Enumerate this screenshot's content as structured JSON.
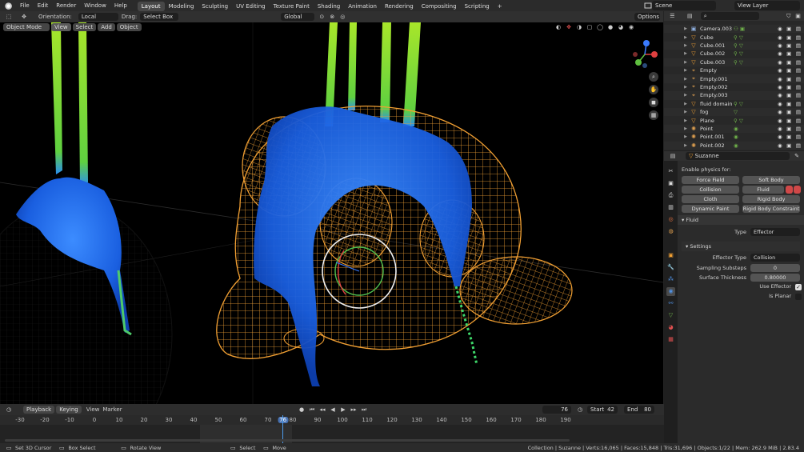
{
  "menu": [
    "File",
    "Edit",
    "Render",
    "Window",
    "Help"
  ],
  "workspaces": [
    "Layout",
    "Modeling",
    "Sculpting",
    "UV Editing",
    "Texture Paint",
    "Shading",
    "Animation",
    "Rendering",
    "Compositing",
    "Scripting"
  ],
  "active_workspace": "Layout",
  "add_workspace": "+",
  "scene": "Scene",
  "view_layer": "View Layer",
  "tool_header": {
    "orientation_label": "Orientation:",
    "orientation_value": "Local",
    "drag_label": "Drag:",
    "drag_value": "Select Box",
    "transform_orientation": "Global",
    "options": "Options"
  },
  "viewport_header": {
    "mode": "Object Mode",
    "view": "View",
    "select": "Select",
    "add": "Add",
    "object": "Object"
  },
  "outliner": {
    "search_placeholder": "",
    "rows": [
      {
        "name": "Camera.003",
        "type": "camera",
        "extra": "⚇ ▣"
      },
      {
        "name": "Cube",
        "type": "mesh",
        "extra": "⚲ ▽"
      },
      {
        "name": "Cube.001",
        "type": "mesh",
        "extra": "⚲ ▽"
      },
      {
        "name": "Cube.002",
        "type": "mesh",
        "extra": "⚲ ▽"
      },
      {
        "name": "Cube.003",
        "type": "mesh",
        "extra": "⚲ ▽"
      },
      {
        "name": "Empty",
        "type": "empty",
        "extra": ""
      },
      {
        "name": "Empty.001",
        "type": "empty",
        "extra": ""
      },
      {
        "name": "Empty.002",
        "type": "empty",
        "extra": ""
      },
      {
        "name": "Empty.003",
        "type": "empty",
        "extra": ""
      },
      {
        "name": "fluid domain",
        "type": "mesh",
        "extra": "⚲ ▽"
      },
      {
        "name": "fog",
        "type": "mesh",
        "extra": "▽"
      },
      {
        "name": "Plane",
        "type": "mesh",
        "extra": "⚲ ▽"
      },
      {
        "name": "Point",
        "type": "light",
        "extra": "◉"
      },
      {
        "name": "Point.001",
        "type": "light",
        "extra": "◉"
      },
      {
        "name": "Point.002",
        "type": "light",
        "extra": "◉"
      }
    ]
  },
  "properties": {
    "object_name": "Suzanne",
    "enable_physics": "Enable physics for:",
    "buttons": {
      "force_field": "Force Field",
      "soft_body": "Soft Body",
      "collision": "Collision",
      "fluid": "Fluid",
      "cloth": "Cloth",
      "rigid_body": "Rigid Body",
      "dynamic_paint": "Dynamic Paint",
      "rigid_body_constraint": "Rigid Body Constraint"
    },
    "fluid_section": "Fluid",
    "type_label": "Type",
    "type_value": "Effector",
    "settings_section": "Settings",
    "effector_type_label": "Effector Type",
    "effector_type_value": "Collision",
    "sampling_label": "Sampling Substeps",
    "sampling_value": "0",
    "thickness_label": "Surface Thickness",
    "thickness_value": "0.80000",
    "use_effector_label": "Use Effector",
    "use_effector": true,
    "is_planar_label": "Is Planar",
    "is_planar": false
  },
  "timeline": {
    "playback": "Playback",
    "keying": "Keying",
    "view": "View",
    "marker": "Marker",
    "current_frame": "76",
    "start_label": "Start",
    "start": "42",
    "end_label": "End",
    "end": "80",
    "ticks": [
      "-30",
      "-20",
      "-10",
      "0",
      "10",
      "20",
      "30",
      "40",
      "50",
      "60",
      "70",
      "76",
      "80",
      "90",
      "100",
      "110",
      "120",
      "130",
      "140",
      "150",
      "160",
      "170",
      "180",
      "190"
    ]
  },
  "statusbar": {
    "set_cursor": "Set 3D Cursor",
    "box_select": "Box Select",
    "rotate_view": "Rotate View",
    "select": "Select",
    "move": "Move",
    "stats": "Collection | Suzanne | Verts:16,065 | Faces:15,848 | Tris:31,696 | Objects:1/22 | Mem: 262.9 MiB | 2.83.4"
  },
  "colors": {
    "wire": "#f2a033",
    "fluid_blue": "#1e6cf0",
    "fluid_green": "#9be02a",
    "accent": "#4772b3"
  }
}
